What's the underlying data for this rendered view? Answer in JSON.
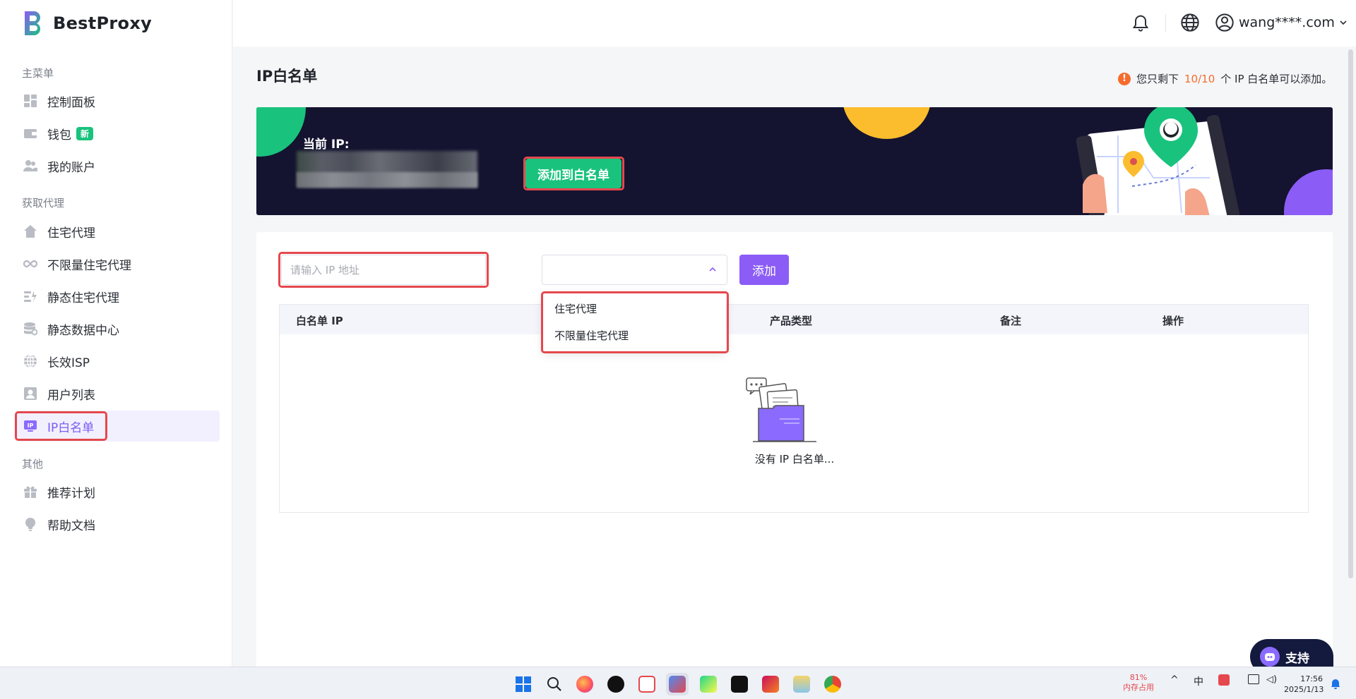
{
  "brand": {
    "name": "BestProxy",
    "accent": "#8b5cf6",
    "green": "#19c37d"
  },
  "sidebar": {
    "section_main": "主菜单",
    "section_proxy": "获取代理",
    "section_other": "其他",
    "items": [
      {
        "label": "控制面板",
        "icon": "dashboard-icon"
      },
      {
        "label": "钱包",
        "icon": "wallet-icon",
        "badge": "新"
      },
      {
        "label": "我的账户",
        "icon": "users-icon"
      },
      {
        "label": "住宅代理",
        "icon": "home-icon"
      },
      {
        "label": "不限量住宅代理",
        "icon": "infinity-icon"
      },
      {
        "label": "静态住宅代理",
        "icon": "static-icon"
      },
      {
        "label": "静态数据中心",
        "icon": "database-icon"
      },
      {
        "label": "长效ISP",
        "icon": "globe-icon"
      },
      {
        "label": "用户列表",
        "icon": "user-list-icon"
      },
      {
        "label": "IP白名单",
        "icon": "ip-icon",
        "active": true
      },
      {
        "label": "推荐计划",
        "icon": "gift-icon"
      },
      {
        "label": "帮助文档",
        "icon": "bulb-icon"
      }
    ]
  },
  "header": {
    "user": "wang****.com"
  },
  "page": {
    "title": "IP白名单",
    "notice_prefix": "您只剩下",
    "notice_count": "10/10",
    "notice_suffix": "个 IP 白名单可以添加。"
  },
  "banner": {
    "current_ip_label": "当前 IP:",
    "add_button": "添加到白名单"
  },
  "form": {
    "ip_placeholder": "请输入 IP 地址",
    "product_value": "",
    "add_button": "添加",
    "dropdown_options": [
      "住宅代理",
      "不限量住宅代理"
    ]
  },
  "table": {
    "columns": [
      "白名单 IP",
      "产品类型",
      "备注",
      "操作"
    ],
    "rows": [],
    "empty_text": "没有 IP 白名单..."
  },
  "support": {
    "label": "支持"
  },
  "taskbar": {
    "memory_percent": "81%",
    "memory_label": "内存占用",
    "time": "17:56",
    "date": "2025/1/13",
    "ime": "中"
  }
}
